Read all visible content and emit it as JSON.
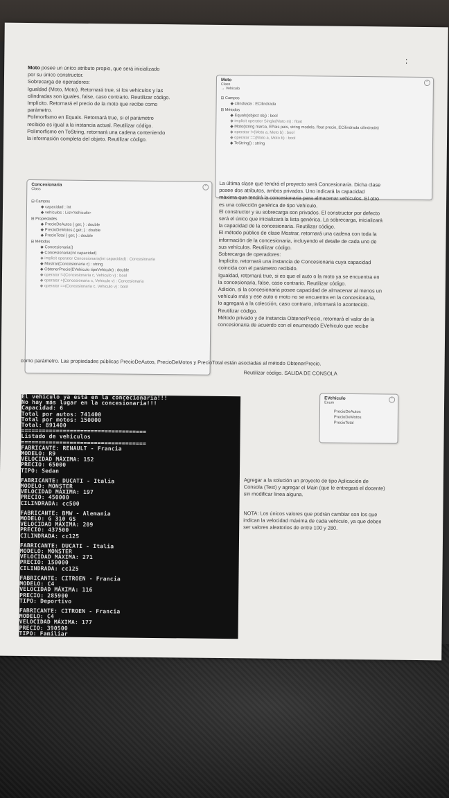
{
  "page_marker": ":",
  "intro": {
    "lines": [
      {
        "bold": "Moto",
        "text": " posee un único atributo propio, que será inicializado"
      },
      {
        "bold": "",
        "text": "por su único constructor."
      },
      {
        "bold": "",
        "text": "Sobrecarga de operadores:"
      },
      {
        "bold": "",
        "text": "Igualdad (Moto, Moto). Retornará true, si los vehículos y las"
      },
      {
        "bold": "",
        "text": "cilindradas son iguales, false, caso contrario. Reutilizar código."
      },
      {
        "bold": "",
        "text": "Implícito. Retornará el precio de la moto que recibe como"
      },
      {
        "bold": "",
        "text": "parámetro."
      },
      {
        "bold": "",
        "text": "Polimorfismo en Equals. Retornará true, si el parámetro"
      },
      {
        "bold": "",
        "text": "recibido es igual a la instancia actual. Reutilizar código."
      },
      {
        "bold": "",
        "text": "Polimorfismo en ToString, retornará una cadena conteniendo"
      },
      {
        "bold": "",
        "text": "la información completa del objeto. Reutilizar código."
      }
    ]
  },
  "moto_box": {
    "title": "Moto",
    "kind": "Class",
    "base": "→ Vehiculo",
    "sections": [
      {
        "label": "Campos",
        "rows": [
          {
            "text": "cilindrada : ECilindrada",
            "faint": false
          }
        ]
      },
      {
        "label": "Métodos",
        "rows": [
          {
            "text": "Equals(object obj) : bool",
            "faint": false
          },
          {
            "text": "implicit operator Single(Moto m) : float",
            "faint": true
          },
          {
            "text": "Moto(string marca, EPais pais, string modelo, float precio, ECilindrada cilindrada)",
            "faint": false
          },
          {
            "text": "operator !=(Moto a, Moto b) : bool",
            "faint": true
          },
          {
            "text": "operator ==(Moto a, Moto b) : bool",
            "faint": true
          },
          {
            "text": "ToString() : string",
            "faint": false
          }
        ]
      }
    ]
  },
  "concesionaria_box": {
    "title": "Concesionaria",
    "kind": "Class",
    "sections": [
      {
        "label": "Campos",
        "rows": [
          {
            "text": "capacidad : int",
            "faint": false
          },
          {
            "text": "vehiculos : List<Vehiculo>",
            "faint": false
          }
        ]
      },
      {
        "label": "Propiedades",
        "rows": [
          {
            "text": "PrecioDeAutos { get; } : double",
            "faint": false
          },
          {
            "text": "PrecioDeMotos { get; } : double",
            "faint": false
          },
          {
            "text": "PrecioTotal { get; } : double",
            "faint": false
          }
        ]
      },
      {
        "label": "Métodos",
        "rows": [
          {
            "text": "Concesionaria()",
            "faint": false
          },
          {
            "text": "Concesionaria(int capacidad)",
            "faint": false
          },
          {
            "text": "implicit operator Concesionaria(int capacidad) : Concesionaria",
            "faint": true
          },
          {
            "text": "Mostrar(Concesionaria c) : string",
            "faint": false
          },
          {
            "text": "ObtenerPrecio(EVehiculo tipoVehiculo) : double",
            "faint": false
          },
          {
            "text": "operator !=(Concesionaria c, Vehiculo v) : bool",
            "faint": true
          },
          {
            "text": "operator +(Concesionaria c, Vehiculo v) : Concesionaria",
            "faint": true
          },
          {
            "text": "operator ==(Concesionaria c, Vehiculo v) : bool",
            "faint": true
          }
        ]
      }
    ]
  },
  "right_text": {
    "lines": [
      "La última clase que tendrá el proyecto será Concesionaria. Dicha clase",
      "posee dos atributos, ambos privados. Uno indicará la capacidad",
      "máxima que tendrá la concesionaria para almacenar vehículos. El otro",
      "es una colección genérica de tipo Vehículo.",
      "El constructor y su sobrecarga son privados. El constructor por defecto",
      "será el único que inicializará la lista genérica. La sobrecarga, inicializará",
      "la capacidad de la concesionaria. Reutilizar código.",
      "El método público de clase Mostrar, retornará una cadena con toda la",
      "información de la concesionaria, incluyendo el detalle de cada uno de",
      "sus vehículos. Reutilizar código.",
      "Sobrecarga de operadores:",
      "Implícito, retornará una instancia de Concesionaria cuya capacidad",
      "coincida con el parámetro recibido.",
      "Igualdad, retornará true, si es que el auto o la moto ya se encuentra en",
      "la concesionaria, false, caso contrario. Reutilizar código.",
      "Adición, si la concesionaria posee capacidad de almacenar al menos un",
      "vehículo más y ese auto o moto no se encuentra en la concesionaria,",
      "lo agregará a la colección, caso contrario, informará lo acontecido.",
      "Reutilizar código.",
      "Método privado y de instancia ObtenerPrecio, retornará el valor de la",
      "concesionaria de acuerdo con el enumerado EVehiculo que recibe"
    ]
  },
  "full_line": "como parámetro. Las propiedades públicas PrecioDeAutos, PrecioDeMotos y PrecioTotal están asociadas al método ObtenerPrecio.",
  "salida_line": "Reutilizar código. SALIDA DE CONSOLA",
  "evehiculo_box": {
    "title": "EVehiculo",
    "kind": "Enum",
    "values": [
      "PrecioDeAutos",
      "PrecioDeMotos",
      "PrecioTotal"
    ]
  },
  "instructions": [
    "Agregar a la solución un proyecto de tipo Aplicación de",
    "Consola (Test) y agregar el Main (que le entregará el docente)",
    "sin modificar línea alguna."
  ],
  "nota": [
    "NOTA: Los únicos valores que podrán cambiar son los que",
    "indican la velocidad máxima de cada vehículo, ya que deben",
    "ser valores aleatorios de entre 100 y 280."
  ],
  "console": {
    "blocks": [
      [
        "El vehiculo ya está en la concecionaria!!!",
        "No hay más lugar en la concesionaria!!!",
        "Capacidad: 6",
        "Total por autos: 741400",
        "Total por motos: 150000",
        "Total: 891400",
        "====================================",
        "Listado de vehiculos",
        "====================================",
        "FABRICANTE: RENAULT - Francia",
        "MODELO: R9",
        "VELOCIDAD MÁXIMA: 152",
        "PRECIO: 65000",
        "TIPO: Sedan"
      ],
      [
        "FABRICANTE: DUCATI - Italia",
        "MODELO: MONSTER",
        "VELOCIDAD MÁXIMA: 197",
        "PRECIO: 450000",
        "CILINDRADA: cc500"
      ],
      [
        "FABRICANTE: BMW - Alemania",
        "MODELO: G 310 GS",
        "VELOCIDAD MÁXIMA: 209",
        "PRECIO: 437500",
        "CILINDRADA: cc125"
      ],
      [
        "FABRICANTE: DUCATI - Italia",
        "MODELO: MONSTER",
        "VELOCIDAD MÁXIMA: 271",
        "PRECIO: 150000",
        "CILINDRADA: cc125"
      ],
      [
        "FABRICANTE: CITROEN - Francia",
        "MODELO: C4",
        "VELOCIDAD MÁXIMA: 116",
        "PRECIO: 285900",
        "TIPO: Deportivo"
      ],
      [
        "FABRICANTE: CITROEN - Francia",
        "MODELO: C4",
        "VELOCIDAD MÁXIMA: 177",
        "PRECIO: 390500",
        "TIPO: Familiar"
      ]
    ]
  }
}
